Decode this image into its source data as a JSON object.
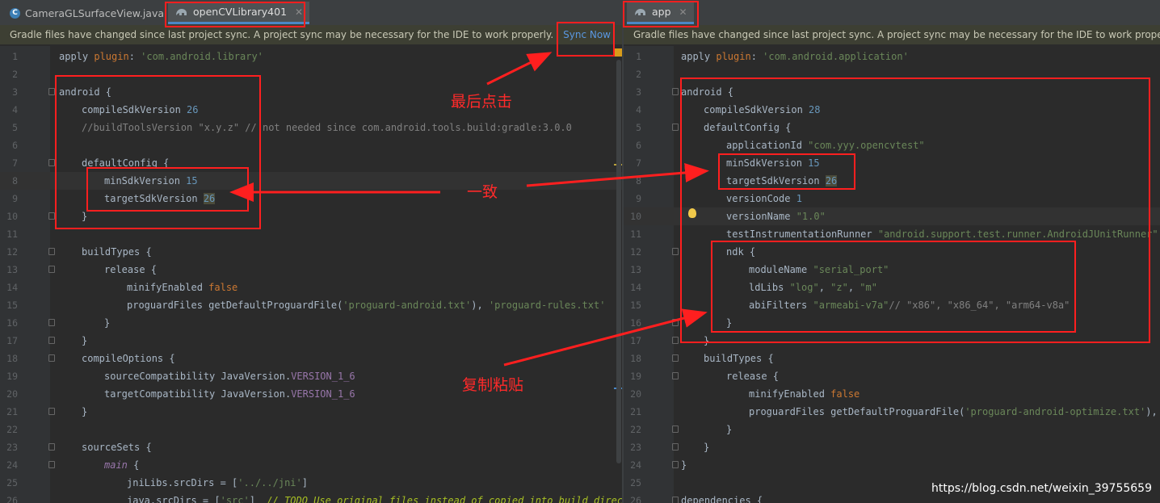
{
  "left": {
    "tabs": [
      {
        "label": "CameraGLSurfaceView.java",
        "icon": "java-class-icon"
      },
      {
        "label": "openCVLibrary401",
        "icon": "gradle-icon"
      }
    ],
    "notification": "Gradle files have changed since last project sync. A project sync may be necessary for the IDE to work properly.",
    "sync_label": "Sync Now",
    "line_numbers": [
      "1",
      "2",
      "3",
      "4",
      "5",
      "6",
      "7",
      "8",
      "9",
      "10",
      "11",
      "12",
      "13",
      "14",
      "15",
      "16",
      "17",
      "18",
      "19",
      "20",
      "21",
      "22",
      "23",
      "24",
      "25",
      "26"
    ]
  },
  "right": {
    "tabs": [
      {
        "label": "app",
        "icon": "gradle-icon"
      }
    ],
    "notification": "Gradle files have changed since last project sync. A project sync may be necessary for the IDE to work properly.",
    "line_numbers": [
      "1",
      "2",
      "3",
      "4",
      "5",
      "6",
      "7",
      "8",
      "9",
      "10",
      "11",
      "12",
      "13",
      "14",
      "15",
      "16",
      "17",
      "18",
      "19",
      "20",
      "21",
      "22",
      "23",
      "24",
      "25",
      "26"
    ]
  },
  "annotations": {
    "sync_hint": "最后点击",
    "match_hint": "一致",
    "copy_hint": "复制粘贴"
  },
  "watermark": "https://blog.csdn.net/weixin_39755659",
  "colors": {
    "annotation": "#ff1f1f",
    "keyword": "#cc7832",
    "string": "#6a8759",
    "number": "#6897bb",
    "comment": "#808080",
    "default": "#a9b7c6"
  }
}
